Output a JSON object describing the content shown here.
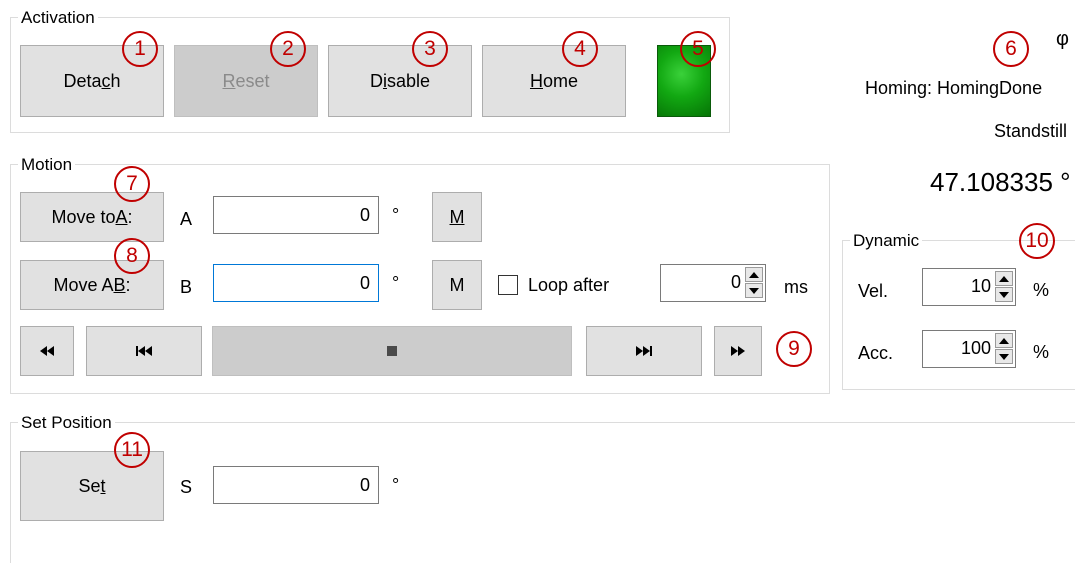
{
  "activation": {
    "title": "Activation",
    "detach": [
      "Deta",
      "c",
      "h"
    ],
    "reset": [
      "",
      "R",
      "eset"
    ],
    "disable": [
      "D",
      "i",
      "sable"
    ],
    "home": [
      "",
      "H",
      "ome"
    ]
  },
  "status": {
    "phi_symbol": "φ",
    "homing": "Homing: HomingDone",
    "state": "Standstill",
    "position": "47.108335 °"
  },
  "motion": {
    "title": "Motion",
    "move_a": [
      "Move to ",
      "A",
      ":"
    ],
    "move_ab": [
      "Move A",
      "B",
      ":"
    ],
    "label_a": "A",
    "label_b": "B",
    "value_a": "0",
    "value_b": "0",
    "unit_deg": "°",
    "m_a": [
      "",
      "M",
      ""
    ],
    "m_b": "M",
    "loop_label": "Loop after",
    "loop_checked": false,
    "loop_value": "0",
    "loop_unit": "ms",
    "icons": [
      "rewind-icon",
      "skip-back-icon",
      "stop-icon",
      "skip-forward-icon",
      "fast-forward-icon"
    ]
  },
  "dynamic": {
    "title": "Dynamic",
    "vel_label": "Vel.",
    "vel_value": "10",
    "vel_unit": "%",
    "acc_label": "Acc.",
    "acc_value": "100",
    "acc_unit": "%"
  },
  "set_position": {
    "title": "Set Position",
    "set": [
      "Se",
      "t",
      ""
    ],
    "label_s": "S",
    "value_s": "0",
    "unit_deg": "°"
  },
  "markers": [
    "1",
    "2",
    "3",
    "4",
    "5",
    "6",
    "7",
    "8",
    "9",
    "10",
    "11"
  ],
  "colors": {
    "accent": "#0078d7",
    "marker": "#c00000",
    "led": "#12a812",
    "button": "#e1e1e1"
  }
}
